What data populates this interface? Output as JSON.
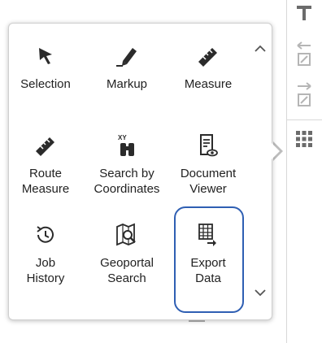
{
  "colors": {
    "icon_dark": "#2b2b2b",
    "icon_gray": "#9e9e9e",
    "highlight": "#2f5fb3"
  },
  "toolbar": {
    "top_icon": "pin-icon",
    "buttons": [
      {
        "name": "undo-arrow-icon"
      },
      {
        "name": "redo-arrow-icon"
      },
      {
        "name": "grid-menu-icon"
      }
    ]
  },
  "tools": [
    {
      "id": "selection",
      "label": "Selection",
      "icon": "cursor-icon"
    },
    {
      "id": "markup",
      "label": "Markup",
      "icon": "marker-icon"
    },
    {
      "id": "measure",
      "label": "Measure",
      "icon": "ruler-icon"
    },
    {
      "id": "route-measure",
      "label": "Route\nMeasure",
      "icon": "ruler-icon"
    },
    {
      "id": "search-by-coordinates",
      "label": "Search by\nCoordinates",
      "icon": "binoculars-icon"
    },
    {
      "id": "document-viewer",
      "label": "Document\nViewer",
      "icon": "document-eye-icon"
    },
    {
      "id": "job-history",
      "label": "Job\nHistory",
      "icon": "history-clock-icon"
    },
    {
      "id": "geoportal-search",
      "label": "Geoportal\nSearch",
      "icon": "map-search-icon"
    },
    {
      "id": "export-data",
      "label": "Export\nData",
      "icon": "table-export-icon"
    }
  ],
  "scroll": {
    "up_icon": "chevron-up-icon",
    "down_icon": "chevron-down-icon"
  }
}
